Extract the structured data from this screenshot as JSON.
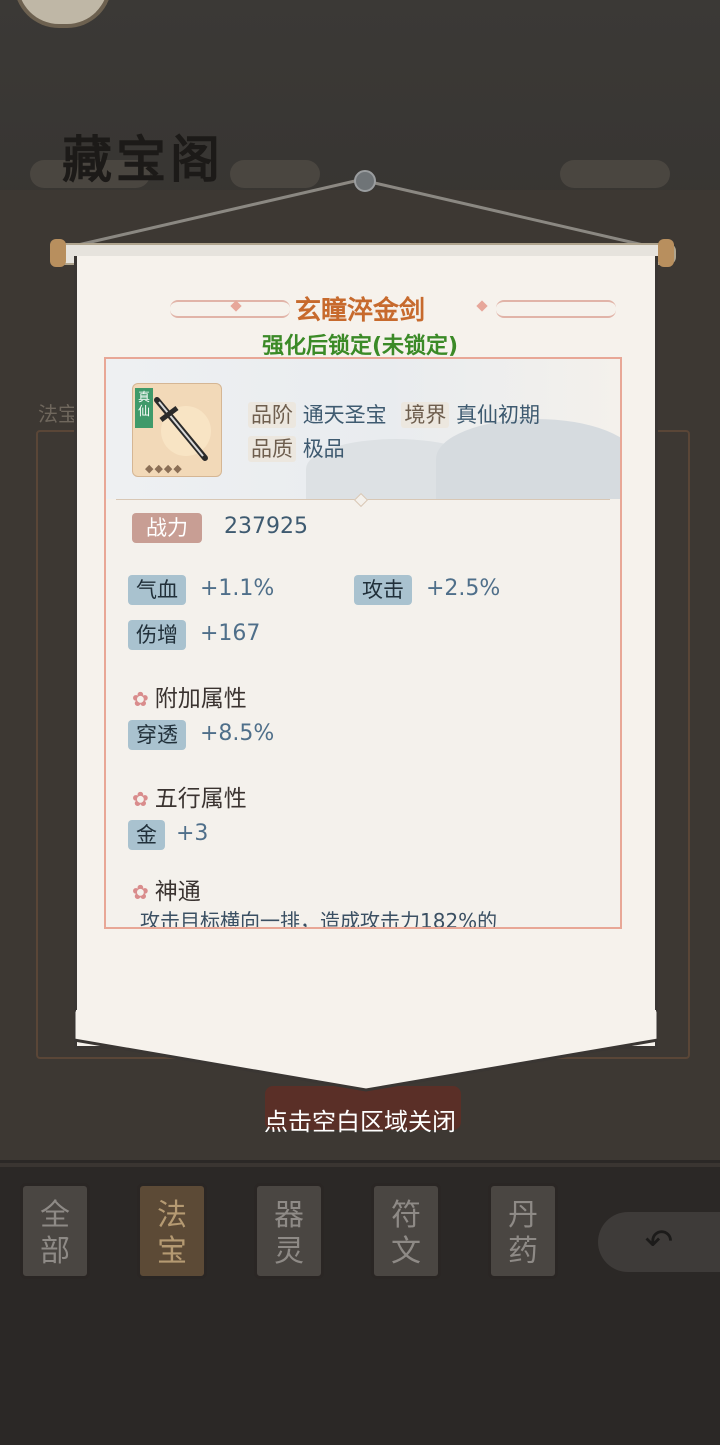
{
  "header": {
    "title": "藏宝阁"
  },
  "background": {
    "side_label": "法宝"
  },
  "popup": {
    "item_name": "玄瞳淬金剑",
    "lock_status": "强化后锁定(未锁定)",
    "icon": {
      "name": "sword-icon",
      "tag": "真仙"
    },
    "grade_label": "品阶",
    "grade_value": "通天圣宝",
    "realm_label": "境界",
    "realm_value": "真仙初期",
    "quality_label": "品质",
    "quality_value": "极品",
    "power_label": "战力",
    "power_value": "237925",
    "base_stats": [
      {
        "name": "气血",
        "value": "+1.1%"
      },
      {
        "name": "攻击",
        "value": "+2.5%"
      },
      {
        "name": "伤增",
        "value": "+167"
      }
    ],
    "extra_section": "附加属性",
    "extra_stats": [
      {
        "name": "穿透",
        "value": "+8.5%"
      }
    ],
    "element_section": "五行属性",
    "element_stats": [
      {
        "name": "金",
        "value": "+3"
      }
    ],
    "skill_section": "神通",
    "skill_desc": "攻击目标横向一排，造成攻击力182%的"
  },
  "close_hint": "点击空白区域关闭",
  "tabs": [
    {
      "label_top": "全",
      "label_bottom": "部"
    },
    {
      "label_top": "法",
      "label_bottom": "宝"
    },
    {
      "label_top": "器",
      "label_bottom": "灵"
    },
    {
      "label_top": "符",
      "label_bottom": "文"
    },
    {
      "label_top": "丹",
      "label_bottom": "药"
    }
  ],
  "colors": {
    "accent_orange": "#c76a2d",
    "accent_green": "#3b8a27",
    "stat_badge": "#a9c2cf",
    "power_badge": "#c89e94"
  }
}
